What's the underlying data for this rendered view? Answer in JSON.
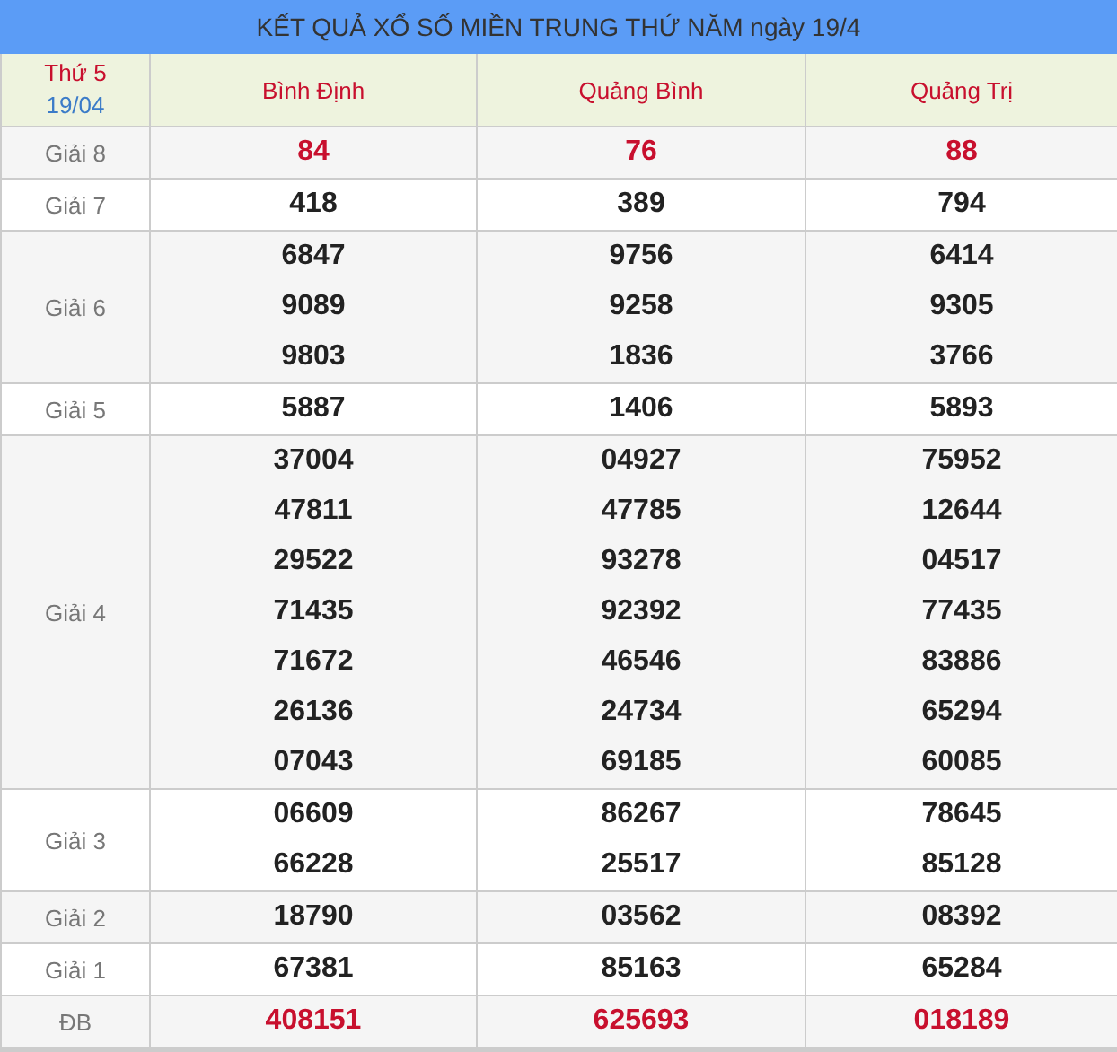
{
  "title": "KẾT QUẢ XỔ SỐ MIỀN TRUNG THỨ NĂM ngày 19/4",
  "corner": {
    "weekday": "Thứ 5",
    "date": "19/04"
  },
  "provinces": [
    "Bình Định",
    "Quảng Bình",
    "Quảng Trị"
  ],
  "rows": [
    {
      "label": "Giải 8",
      "highlight": true,
      "results": [
        [
          "84"
        ],
        [
          "76"
        ],
        [
          "88"
        ]
      ]
    },
    {
      "label": "Giải 7",
      "highlight": false,
      "results": [
        [
          "418"
        ],
        [
          "389"
        ],
        [
          "794"
        ]
      ]
    },
    {
      "label": "Giải 6",
      "highlight": false,
      "results": [
        [
          "6847",
          "9089",
          "9803"
        ],
        [
          "9756",
          "9258",
          "1836"
        ],
        [
          "6414",
          "9305",
          "3766"
        ]
      ]
    },
    {
      "label": "Giải 5",
      "highlight": false,
      "results": [
        [
          "5887"
        ],
        [
          "1406"
        ],
        [
          "5893"
        ]
      ]
    },
    {
      "label": "Giải 4",
      "highlight": false,
      "results": [
        [
          "37004",
          "47811",
          "29522",
          "71435",
          "71672",
          "26136",
          "07043"
        ],
        [
          "04927",
          "47785",
          "93278",
          "92392",
          "46546",
          "24734",
          "69185"
        ],
        [
          "75952",
          "12644",
          "04517",
          "77435",
          "83886",
          "65294",
          "60085"
        ]
      ]
    },
    {
      "label": "Giải 3",
      "highlight": false,
      "results": [
        [
          "06609",
          "66228"
        ],
        [
          "86267",
          "25517"
        ],
        [
          "78645",
          "85128"
        ]
      ]
    },
    {
      "label": "Giải 2",
      "highlight": false,
      "results": [
        [
          "18790"
        ],
        [
          "03562"
        ],
        [
          "08392"
        ]
      ]
    },
    {
      "label": "Giải 1",
      "highlight": false,
      "results": [
        [
          "67381"
        ],
        [
          "85163"
        ],
        [
          "65284"
        ]
      ]
    },
    {
      "label": "ĐB",
      "highlight": true,
      "results": [
        [
          "408151"
        ],
        [
          "625693"
        ],
        [
          "018189"
        ]
      ]
    }
  ]
}
